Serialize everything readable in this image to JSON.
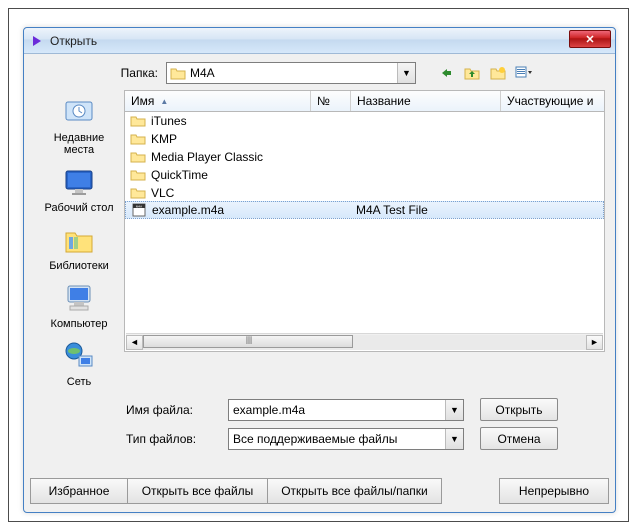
{
  "title": "Открыть",
  "lookin": {
    "label": "Папка:",
    "folder": "M4A"
  },
  "nav_icons": [
    "back-icon",
    "up-icon",
    "new-folder-icon",
    "view-menu-icon"
  ],
  "places": [
    {
      "name": "recent",
      "label": "Недавние места"
    },
    {
      "name": "desktop",
      "label": "Рабочий стол"
    },
    {
      "name": "libraries",
      "label": "Библиотеки"
    },
    {
      "name": "computer",
      "label": "Компьютер"
    },
    {
      "name": "network",
      "label": "Сеть"
    }
  ],
  "columns": {
    "name": "Имя",
    "no": "№",
    "title": "Название",
    "participants": "Участвующие и"
  },
  "files": [
    {
      "type": "folder",
      "name": "iTunes",
      "no": "",
      "title": ""
    },
    {
      "type": "folder",
      "name": "KMP",
      "no": "",
      "title": ""
    },
    {
      "type": "folder",
      "name": "Media Player Classic",
      "no": "",
      "title": ""
    },
    {
      "type": "folder",
      "name": "QuickTime",
      "no": "",
      "title": ""
    },
    {
      "type": "folder",
      "name": "VLC",
      "no": "",
      "title": ""
    },
    {
      "type": "file",
      "name": "example.m4a",
      "no": "",
      "title": "M4A Test File",
      "selected": true
    }
  ],
  "fields": {
    "filename_label": "Имя файла:",
    "filename_value": "example.m4a",
    "filetype_label": "Тип файлов:",
    "filetype_value": "Все поддерживаемые файлы"
  },
  "buttons": {
    "open": "Открыть",
    "cancel": "Отмена"
  },
  "bottom": {
    "favorites": "Избранное",
    "open_all_files": "Открыть все файлы",
    "open_all_folders": "Открыть все файлы/папки",
    "continuous": "Непрерывно"
  }
}
